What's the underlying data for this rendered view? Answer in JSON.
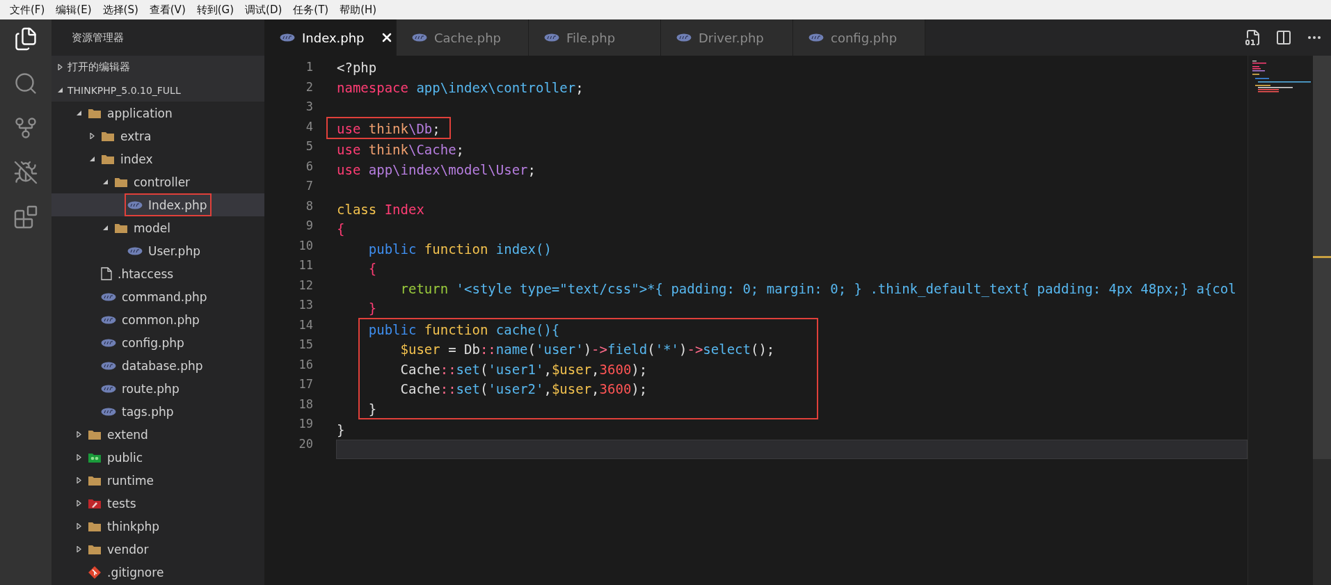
{
  "menu": [
    "文件(F)",
    "编辑(E)",
    "选择(S)",
    "查看(V)",
    "转到(G)",
    "调试(D)",
    "任务(T)",
    "帮助(H)"
  ],
  "activity": [
    {
      "kind": "explorer",
      "selected": true
    },
    {
      "kind": "search",
      "selected": false
    },
    {
      "kind": "scm",
      "selected": false
    },
    {
      "kind": "debug",
      "selected": false
    },
    {
      "kind": "extensions",
      "selected": false
    }
  ],
  "explorer": {
    "title": "资源管理器",
    "sections": [
      {
        "label": "打开的编辑器",
        "expanded": false
      },
      {
        "label": "THINKPHP_5.0.10_FULL",
        "expanded": true,
        "children": [
          {
            "label": "application",
            "kind": "folder",
            "expanded": true,
            "selected": false,
            "marked": false,
            "children": [
              {
                "label": "extra",
                "kind": "folder",
                "expanded": false,
                "selected": false,
                "marked": false
              },
              {
                "label": "index",
                "kind": "folder",
                "expanded": true,
                "selected": false,
                "marked": false,
                "children": [
                  {
                    "label": "controller",
                    "kind": "folder",
                    "expanded": true,
                    "selected": false,
                    "marked": false,
                    "children": [
                      {
                        "label": "Index.php",
                        "kind": "php",
                        "selected": true,
                        "marked": true
                      }
                    ]
                  },
                  {
                    "label": "model",
                    "kind": "folder",
                    "expanded": true,
                    "selected": false,
                    "marked": false,
                    "children": [
                      {
                        "label": "User.php",
                        "kind": "php",
                        "selected": false,
                        "marked": false
                      }
                    ]
                  }
                ]
              },
              {
                "label": ".htaccess",
                "kind": "file",
                "selected": false,
                "marked": false
              },
              {
                "label": "command.php",
                "kind": "php",
                "selected": false,
                "marked": false
              },
              {
                "label": "common.php",
                "kind": "php",
                "selected": false,
                "marked": false
              },
              {
                "label": "config.php",
                "kind": "php",
                "selected": false,
                "marked": false
              },
              {
                "label": "database.php",
                "kind": "php",
                "selected": false,
                "marked": false
              },
              {
                "label": "route.php",
                "kind": "php",
                "selected": false,
                "marked": false
              },
              {
                "label": "tags.php",
                "kind": "php",
                "selected": false,
                "marked": false
              }
            ]
          },
          {
            "label": "extend",
            "kind": "folder",
            "expanded": false,
            "selected": false,
            "marked": false
          },
          {
            "label": "public",
            "kind": "public-folder",
            "expanded": false,
            "selected": false,
            "marked": false
          },
          {
            "label": "runtime",
            "kind": "folder",
            "expanded": false,
            "selected": false,
            "marked": false
          },
          {
            "label": "tests",
            "kind": "tests-folder",
            "expanded": false,
            "selected": false,
            "marked": false
          },
          {
            "label": "thinkphp",
            "kind": "folder",
            "expanded": false,
            "selected": false,
            "marked": false
          },
          {
            "label": "vendor",
            "kind": "folder",
            "expanded": false,
            "selected": false,
            "marked": false
          },
          {
            "label": ".gitignore",
            "kind": "git",
            "selected": false,
            "marked": false
          }
        ]
      }
    ]
  },
  "tabs": [
    {
      "label": "Index.php",
      "selected": true
    },
    {
      "label": "Cache.php",
      "selected": false
    },
    {
      "label": "File.php",
      "selected": false
    },
    {
      "label": "Driver.php",
      "selected": false
    },
    {
      "label": "config.php",
      "selected": false
    }
  ],
  "editor_actions": [
    {
      "kind": "binary"
    },
    {
      "kind": "split"
    },
    {
      "kind": "more"
    }
  ],
  "code": [
    {
      "number": "1",
      "marked": false,
      "current": false,
      "tokens": [
        {
          "kind": "plain",
          "text": "<?php"
        }
      ]
    },
    {
      "number": "2",
      "marked": false,
      "current": false,
      "tokens": [
        {
          "kind": "keyword",
          "text": "namespace"
        },
        {
          "kind": "name",
          "text": " app\\index\\controller"
        },
        {
          "kind": "plain",
          "text": ";"
        }
      ]
    },
    {
      "number": "3",
      "marked": false,
      "current": false
    },
    {
      "number": "4",
      "marked": true,
      "current": false,
      "tokens": [
        {
          "kind": "keyword",
          "text": "use"
        },
        {
          "kind": "namespace",
          "text": " think"
        },
        {
          "kind": "class",
          "text": "\\Db"
        },
        {
          "kind": "plain",
          "text": ";"
        }
      ]
    },
    {
      "number": "5",
      "marked": false,
      "current": false,
      "tokens": [
        {
          "kind": "keyword",
          "text": "use"
        },
        {
          "kind": "namespace",
          "text": " think"
        },
        {
          "kind": "class",
          "text": "\\Cache"
        },
        {
          "kind": "plain",
          "text": ";"
        }
      ]
    },
    {
      "number": "6",
      "marked": false,
      "current": false,
      "tokens": [
        {
          "kind": "keyword",
          "text": "use"
        },
        {
          "kind": "class",
          "text": " app\\index\\model\\User"
        },
        {
          "kind": "plain",
          "text": ";"
        }
      ]
    },
    {
      "number": "7",
      "marked": false,
      "current": false
    },
    {
      "number": "8",
      "marked": false,
      "current": false,
      "tokens": [
        {
          "kind": "storage",
          "text": "class"
        },
        {
          "kind": "keyword",
          "text": " Index"
        }
      ]
    },
    {
      "number": "9",
      "marked": false,
      "current": false,
      "tokens": [
        {
          "kind": "keyword",
          "text": "{"
        }
      ],
      "children": [
        {
          "number": "10",
          "marked": false,
          "current": false,
          "tokens": [
            {
              "kind": "modifier",
              "text": "public"
            },
            {
              "kind": "storage",
              "text": " function"
            },
            {
              "kind": "name",
              "text": " index()"
            }
          ]
        },
        {
          "number": "11",
          "marked": false,
          "current": false,
          "tokens": [
            {
              "kind": "keyword",
              "text": "{"
            }
          ],
          "children": [
            {
              "number": "12",
              "marked": false,
              "current": false,
              "tokens": [
                {
                  "kind": "return",
                  "text": "return"
                },
                {
                  "kind": "string",
                  "text": " '<style type=\"text/css\">*{ padding: 0; margin: 0; } .think_default_text{ padding: 4px 48px;} a{col"
                }
              ]
            }
          ]
        },
        {
          "number": "13",
          "marked": false,
          "current": false,
          "tokens": [
            {
              "kind": "keyword",
              "text": "}"
            }
          ]
        },
        {
          "number": "14",
          "marked": true,
          "current": false,
          "tokens": [
            {
              "kind": "modifier",
              "text": "public"
            },
            {
              "kind": "storage",
              "text": " function"
            },
            {
              "kind": "name",
              "text": " cache(){"
            }
          ],
          "children": [
            {
              "number": "15",
              "marked": true,
              "current": false,
              "tokens": [
                {
                  "kind": "variable",
                  "text": "$user"
                },
                {
                  "kind": "plain",
                  "text": " = Db"
                },
                {
                  "kind": "operator",
                  "text": "::"
                },
                {
                  "kind": "name",
                  "text": "name"
                },
                {
                  "kind": "plain",
                  "text": "("
                },
                {
                  "kind": "string",
                  "text": "'user'"
                },
                {
                  "kind": "plain",
                  "text": ")"
                },
                {
                  "kind": "operator",
                  "text": "->"
                },
                {
                  "kind": "name",
                  "text": "field"
                },
                {
                  "kind": "plain",
                  "text": "("
                },
                {
                  "kind": "string",
                  "text": "'*'"
                },
                {
                  "kind": "plain",
                  "text": ")"
                },
                {
                  "kind": "operator",
                  "text": "->"
                },
                {
                  "kind": "name",
                  "text": "select"
                },
                {
                  "kind": "plain",
                  "text": "();"
                }
              ]
            },
            {
              "number": "16",
              "marked": true,
              "current": false,
              "tokens": [
                {
                  "kind": "plain",
                  "text": "Cache"
                },
                {
                  "kind": "operator",
                  "text": "::"
                },
                {
                  "kind": "name",
                  "text": "set"
                },
                {
                  "kind": "plain",
                  "text": "("
                },
                {
                  "kind": "string",
                  "text": "'user1'"
                },
                {
                  "kind": "plain",
                  "text": ","
                },
                {
                  "kind": "variable",
                  "text": "$user"
                },
                {
                  "kind": "plain",
                  "text": ","
                },
                {
                  "kind": "number",
                  "text": "3600"
                },
                {
                  "kind": "plain",
                  "text": ");"
                }
              ]
            },
            {
              "number": "17",
              "marked": true,
              "current": false,
              "tokens": [
                {
                  "kind": "plain",
                  "text": "Cache"
                },
                {
                  "kind": "operator",
                  "text": "::"
                },
                {
                  "kind": "name",
                  "text": "set"
                },
                {
                  "kind": "plain",
                  "text": "("
                },
                {
                  "kind": "string",
                  "text": "'user2'"
                },
                {
                  "kind": "plain",
                  "text": ","
                },
                {
                  "kind": "variable",
                  "text": "$user"
                },
                {
                  "kind": "plain",
                  "text": ","
                },
                {
                  "kind": "number",
                  "text": "3600"
                },
                {
                  "kind": "plain",
                  "text": ");"
                }
              ]
            }
          ]
        },
        {
          "number": "18",
          "marked": true,
          "current": false,
          "tokens": [
            {
              "kind": "plain",
              "text": "}"
            }
          ]
        }
      ]
    },
    {
      "number": "19",
      "marked": false,
      "current": false,
      "tokens": [
        {
          "kind": "plain",
          "text": "}"
        }
      ]
    },
    {
      "number": "20",
      "marked": false,
      "current": true
    }
  ]
}
